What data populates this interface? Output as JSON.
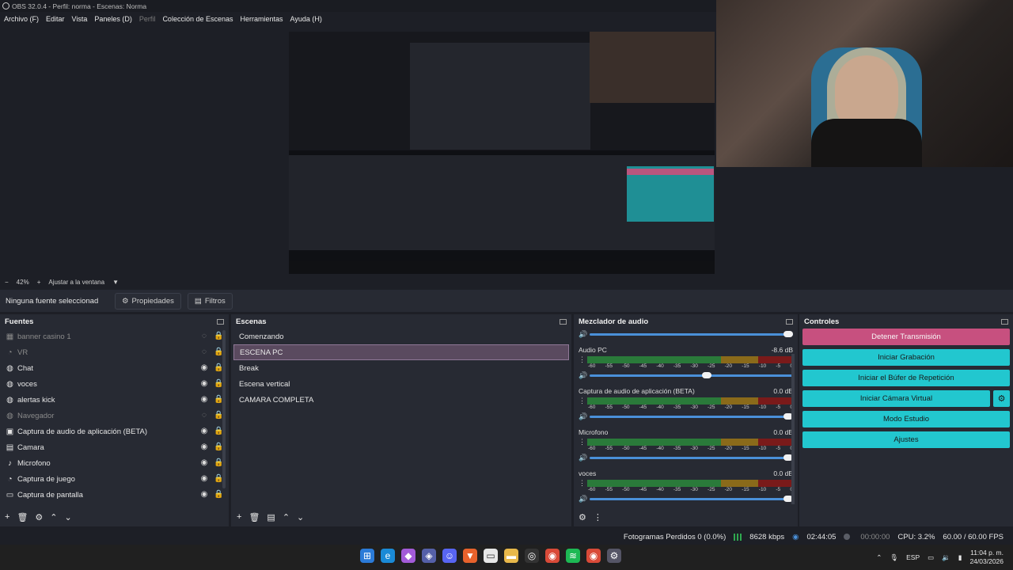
{
  "window": {
    "title": "OBS 32.0.4 - Perfil: norma - Escenas: Norma"
  },
  "menu": [
    "Archivo (F)",
    "Editar",
    "Vista",
    "Paneles (D)",
    "Perfil",
    "Colección de Escenas",
    "Herramientas",
    "Ayuda (H)"
  ],
  "zoom": {
    "level": "42%",
    "fit_label": "Ajustar a la ventana"
  },
  "source_bar": {
    "no_source": "Ninguna fuente seleccionad",
    "properties": "Propiedades",
    "filters": "Filtros"
  },
  "sources": {
    "title": "Fuentes",
    "items": [
      {
        "name": "banner casino 1",
        "icon": "group-icon",
        "visible": false
      },
      {
        "name": "VR",
        "icon": "gamepad-icon",
        "visible": false
      },
      {
        "name": "Chat",
        "icon": "globe-icon",
        "visible": true
      },
      {
        "name": "voces",
        "icon": "globe-icon",
        "visible": true
      },
      {
        "name": "alertas kick",
        "icon": "globe-icon",
        "visible": true
      },
      {
        "name": "Navegador",
        "icon": "globe-icon",
        "visible": false
      },
      {
        "name": "Captura de audio de aplicación (BETA)",
        "icon": "window-icon",
        "visible": true
      },
      {
        "name": "Camara",
        "icon": "camera-icon",
        "visible": true
      },
      {
        "name": "Microfono",
        "icon": "microphone-icon",
        "visible": true
      },
      {
        "name": "Captura de juego",
        "icon": "gamepad-icon",
        "visible": true
      },
      {
        "name": "Captura de pantalla",
        "icon": "monitor-icon",
        "visible": true
      }
    ]
  },
  "scenes": {
    "title": "Escenas",
    "items": [
      "Comenzando",
      "ESCENA PC",
      "Break",
      "Escena vertical",
      "CAMARA COMPLETA"
    ],
    "active": "ESCENA PC"
  },
  "mixer": {
    "title": "Mezclador de audio",
    "channels": [
      {
        "name": "Audio PC",
        "db": "-8.6 dB",
        "level": 0.6
      },
      {
        "name": "Captura de audio de aplicación (BETA)",
        "db": "0.0 dB",
        "level": 1.0
      },
      {
        "name": "Microfono",
        "db": "0.0 dB",
        "level": 1.0
      },
      {
        "name": "voces",
        "db": "0.0 dB",
        "level": 1.0
      }
    ],
    "scale": [
      "-60",
      "-55",
      "-50",
      "-45",
      "-40",
      "-35",
      "-30",
      "-25",
      "-20",
      "-15",
      "-10",
      "-5",
      "0"
    ]
  },
  "controls": {
    "title": "Controles",
    "stop_stream": "Detener Transmisión",
    "start_recording": "Iniciar Grabación",
    "start_replay": "Iniciar el Búfer de Repetición",
    "start_vcam": "Iniciar Cámara Virtual",
    "studio_mode": "Modo Estudio",
    "settings": "Ajustes"
  },
  "status": {
    "dropped": "Fotogramas Perdidos 0 (0.0%)",
    "bitrate": "8628 kbps",
    "stream_time": "02:44:05",
    "rec_time": "00:00:00",
    "cpu": "CPU: 3.2%",
    "fps": "60.00 / 60.00 FPS"
  },
  "taskbar": {
    "lang": "ESP",
    "time": "11:04 p. m.",
    "date": "24/03/2026"
  }
}
